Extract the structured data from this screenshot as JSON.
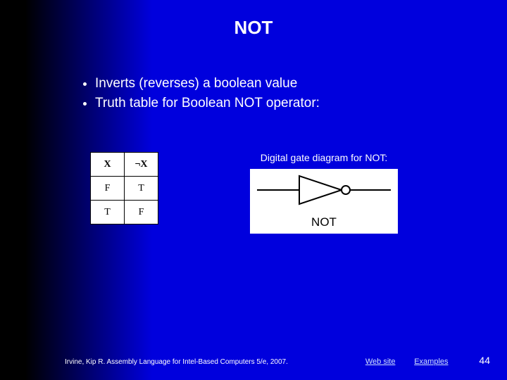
{
  "title": "NOT",
  "bullets": [
    "Inverts (reverses) a boolean value",
    "Truth table for Boolean NOT operator:"
  ],
  "truth_table": {
    "headers": [
      "X",
      "¬X"
    ],
    "rows": [
      [
        "F",
        "T"
      ],
      [
        "T",
        "F"
      ]
    ]
  },
  "gate": {
    "caption": "Digital gate diagram for NOT:",
    "label": "NOT"
  },
  "footer": {
    "citation": "Irvine, Kip R. Assembly Language for Intel-Based Computers 5/e, 2007.",
    "links": [
      "Web site",
      "Examples"
    ],
    "page": "44"
  }
}
